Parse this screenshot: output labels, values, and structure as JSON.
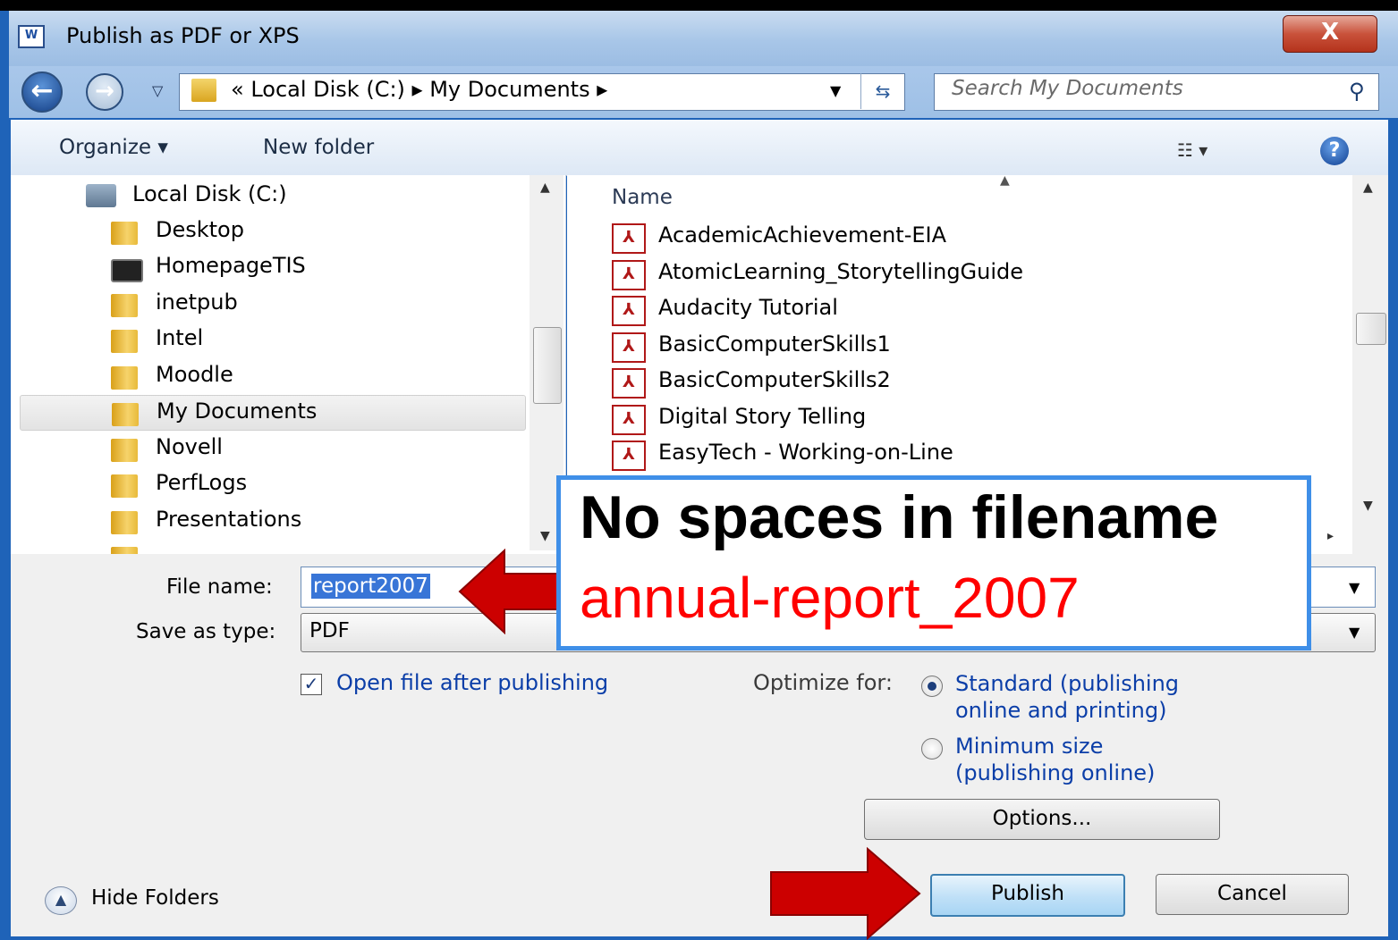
{
  "window": {
    "title": "Publish as PDF or XPS",
    "close_label": "X"
  },
  "navigation": {
    "breadcrumb": [
      "«",
      "Local Disk (C:)",
      "▸",
      "My Documents",
      "▸"
    ],
    "breadcrumb_text": "«  Local Disk (C:)  ▸  My Documents  ▸",
    "search_placeholder": "Search My Documents"
  },
  "toolbar": {
    "organize_label": "Organize ▾",
    "new_folder_label": "New folder"
  },
  "nav_pane": {
    "items": [
      {
        "label": "Local Disk (C:)",
        "icon": "drive-icon"
      },
      {
        "label": "Desktop",
        "icon": "folder-icon"
      },
      {
        "label": "HomepageTIS",
        "icon": "web-folder-icon"
      },
      {
        "label": "inetpub",
        "icon": "folder-icon"
      },
      {
        "label": "Intel",
        "icon": "folder-icon"
      },
      {
        "label": "Moodle",
        "icon": "folder-icon"
      },
      {
        "label": "My Documents",
        "icon": "folder-icon",
        "selected": true
      },
      {
        "label": "Novell",
        "icon": "folder-icon"
      },
      {
        "label": "PerfLogs",
        "icon": "folder-icon"
      },
      {
        "label": "Presentations",
        "icon": "folder-icon"
      }
    ]
  },
  "file_list": {
    "column_header": "Name",
    "files": [
      "AcademicAchievement-EIA",
      "AtomicLearning_StorytellingGuide",
      "Audacity Tutorial",
      "BasicComputerSkills1",
      "BasicComputerSkills2",
      "Digital Story Telling",
      "EasyTech - Working-on-Line"
    ]
  },
  "form": {
    "file_name_label": "File name:",
    "file_name_value": "report2007",
    "save_as_type_label": "Save as type:",
    "save_as_type_value": "PDF",
    "open_after_label": "Open file after publishing",
    "open_after_checked": true,
    "optimize_label": "Optimize for:",
    "standard_label": "Standard (publishing online and printing)",
    "minimum_label": "Minimum size (publishing online)",
    "selected_option": "standard",
    "options_button": "Options...",
    "hide_folders_label": "Hide Folders",
    "publish_button": "Publish",
    "cancel_button": "Cancel"
  },
  "callout": {
    "title": "No spaces in filename",
    "example": "annual-report_2007",
    "example_color": "#ff0000",
    "border_color": "#3f8fe8"
  },
  "colors": {
    "arrow": "#cc0000",
    "link_text": "#0b3ea8",
    "selection": "#3875d7"
  }
}
